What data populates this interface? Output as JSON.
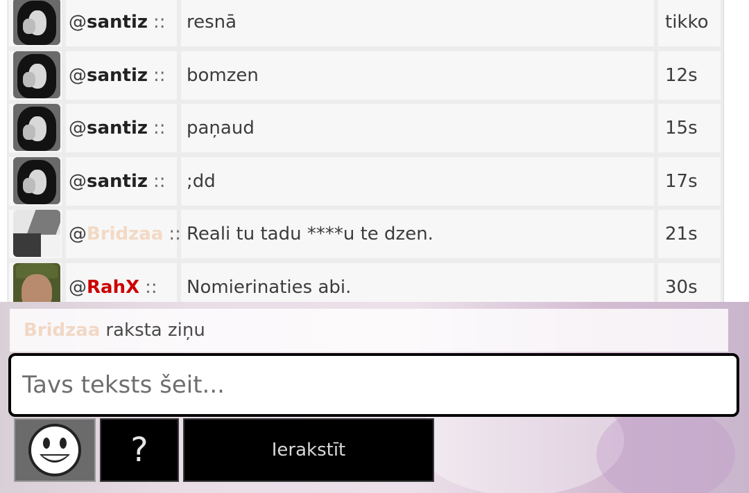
{
  "messages": [
    {
      "user": "santiz",
      "user_color": "#222222",
      "avatar": "santiz",
      "text": "resnā",
      "time": "tikko"
    },
    {
      "user": "santiz",
      "user_color": "#222222",
      "avatar": "santiz",
      "text": "bomzen",
      "time": "12s"
    },
    {
      "user": "santiz",
      "user_color": "#222222",
      "avatar": "santiz",
      "text": "paņaud",
      "time": "15s"
    },
    {
      "user": "santiz",
      "user_color": "#222222",
      "avatar": "santiz",
      "text": ";dd",
      "time": "17s"
    },
    {
      "user": "Bridzaa",
      "user_color": "#f3d9c4",
      "avatar": "bridzaa",
      "text": "Reali tu tadu ****u te dzen.",
      "time": "21s"
    },
    {
      "user": "RahX",
      "user_color": "#cc0000",
      "avatar": "rahx",
      "text": "Nomierinaties abi.",
      "time": "30s"
    }
  ],
  "at_prefix": "@",
  "separator": "::",
  "typing": {
    "user": "Bridzaa",
    "text": "raksta ziņu"
  },
  "input": {
    "placeholder": "Tavs teksts šeit...",
    "value": ""
  },
  "buttons": {
    "smiley_icon": "smiley-icon",
    "help_label": "?",
    "submit_label": "Ierakstīt"
  },
  "colors": {
    "button_bg": "#000000",
    "username_bridzaa": "#f3d9c4",
    "username_rahx": "#cc0000"
  }
}
